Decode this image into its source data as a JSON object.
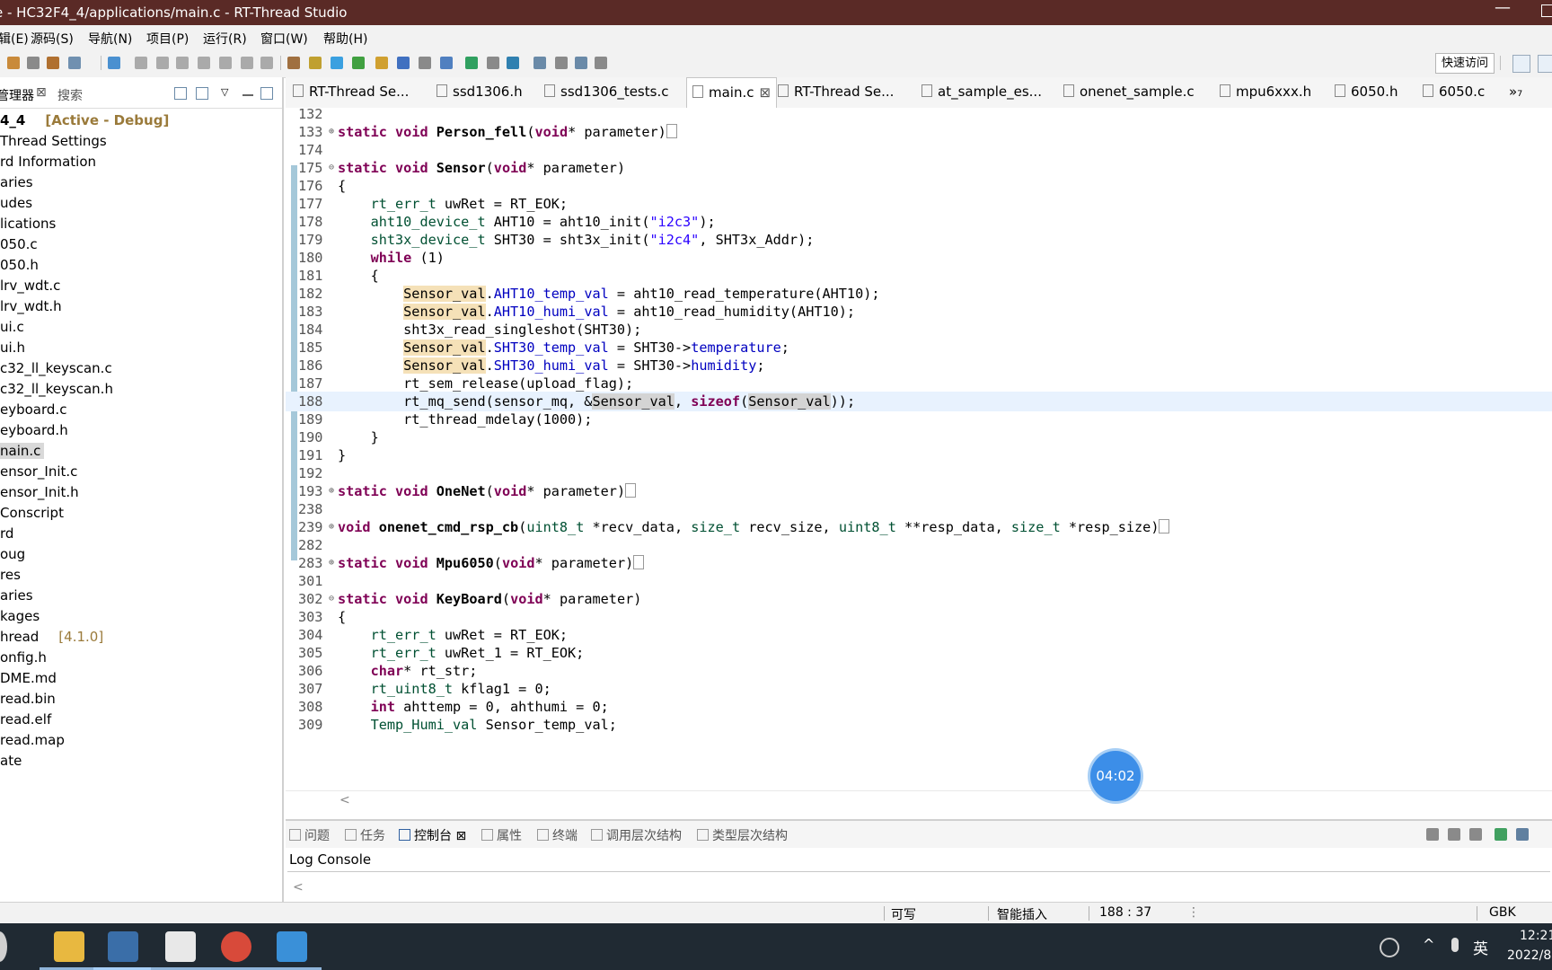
{
  "window": {
    "title": "e - HC32F4_4/applications/main.c - RT-Thread Studio",
    "min": "—"
  },
  "menu": [
    "辑(E)",
    "源码(S)",
    "导航(N)",
    "项目(P)",
    "运行(R)",
    "窗口(W)",
    "帮助(H)"
  ],
  "toolbar": {
    "quick_access": "快速访问"
  },
  "explorer": {
    "tab_label": "管理器",
    "tab_close": "⊠",
    "search_tab": "搜索",
    "items": [
      {
        "text": "4_4",
        "suffix": "[Active - Debug]"
      },
      {
        "text": "Thread Settings"
      },
      {
        "text": "rd Information"
      },
      {
        "text": "aries"
      },
      {
        "text": "udes"
      },
      {
        "text": "lications"
      },
      {
        "text": "050.c"
      },
      {
        "text": "050.h"
      },
      {
        "text": "lrv_wdt.c"
      },
      {
        "text": "lrv_wdt.h"
      },
      {
        "text": "ui.c"
      },
      {
        "text": "ui.h"
      },
      {
        "text": "c32_ll_keyscan.c"
      },
      {
        "text": "c32_ll_keyscan.h"
      },
      {
        "text": "eyboard.c"
      },
      {
        "text": "eyboard.h"
      },
      {
        "text": "nain.c",
        "selected": true
      },
      {
        "text": "ensor_Init.c"
      },
      {
        "text": "ensor_Init.h"
      },
      {
        "text": "Conscript"
      },
      {
        "text": "rd"
      },
      {
        "text": "oug"
      },
      {
        "text": "res"
      },
      {
        "text": "aries"
      },
      {
        "text": "kages"
      },
      {
        "text": "hread",
        "suffix": "[4.1.0]"
      },
      {
        "text": "onfig.h"
      },
      {
        "text": "DME.md"
      },
      {
        "text": "read.bin"
      },
      {
        "text": "read.elf"
      },
      {
        "text": "read.map"
      },
      {
        "text": "ate"
      }
    ]
  },
  "tabs": [
    {
      "label": "RT-Thread Se..."
    },
    {
      "label": "ssd1306.h"
    },
    {
      "label": "ssd1306_tests.c"
    },
    {
      "label": "main.c",
      "active": true,
      "close": "⊠"
    },
    {
      "label": "RT-Thread Se..."
    },
    {
      "label": "at_sample_es..."
    },
    {
      "label": "onenet_sample.c"
    },
    {
      "label": "mpu6xxx.h"
    },
    {
      "label": "6050.h"
    },
    {
      "label": "6050.c"
    },
    {
      "label": "»₇"
    }
  ],
  "code_lines": [
    {
      "n": "132",
      "c": ""
    },
    {
      "n": "133",
      "f": "⊕",
      "c": "<span class='kw'>static</span> <span class='kw'>void</span> <span class='fn'>Person_fell</span>(<span class='kw'>void</span>* parameter)<span class='collapsed'></span>"
    },
    {
      "n": "174",
      "c": ""
    },
    {
      "n": "175",
      "f": "⊖",
      "c": "<span class='kw'>static</span> <span class='kw'>void</span> <span class='fn'>Sensor</span>(<span class='kw'>void</span>* parameter)"
    },
    {
      "n": "176",
      "c": "{"
    },
    {
      "n": "177",
      "c": "    <span class='ty'>rt_err_t</span> uwRet = RT_EOK;"
    },
    {
      "n": "178",
      "c": "    <span class='ty'>aht10_device_t</span> AHT10 = aht10_init(<span class='str'>\"i2c3\"</span>);"
    },
    {
      "n": "179",
      "c": "    <span class='ty'>sht3x_device_t</span> SHT30 = sht3x_init(<span class='str'>\"i2c4\"</span>, SHT3x_Addr);"
    },
    {
      "n": "180",
      "c": "    <span class='kw'>while</span> (1)"
    },
    {
      "n": "181",
      "c": "    {"
    },
    {
      "n": "182",
      "c": "        <span class='hl'>Sensor_val</span>.<span class='fld'>AHT10_temp_val</span> = aht10_read_temperature(AHT10);"
    },
    {
      "n": "183",
      "c": "        <span class='hl'>Sensor_val</span>.<span class='fld'>AHT10_humi_val</span> = aht10_read_humidity(AHT10);"
    },
    {
      "n": "184",
      "c": "        sht3x_read_singleshot(SHT30);"
    },
    {
      "n": "185",
      "c": "        <span class='hl'>Sensor_val</span>.<span class='fld'>SHT30_temp_val</span> = SHT30-><span class='fld'>temperature</span>;"
    },
    {
      "n": "186",
      "c": "        <span class='hl'>Sensor_val</span>.<span class='fld'>SHT30_humi_val</span> = SHT30-><span class='fld'>humidity</span>;"
    },
    {
      "n": "187",
      "c": "        rt_sem_release(upload_flag);"
    },
    {
      "n": "188",
      "current": true,
      "c": "        rt_mq_send(sensor_mq, &amp;<span class='hl2'>Sensor_val</span>, <span class='kw'>sizeof</span>(<span class='hl2'>Sensor_val</span>));"
    },
    {
      "n": "189",
      "c": "        rt_thread_mdelay(1000);"
    },
    {
      "n": "190",
      "c": "    }"
    },
    {
      "n": "191",
      "c": "}"
    },
    {
      "n": "192",
      "c": ""
    },
    {
      "n": "193",
      "f": "⊕",
      "c": "<span class='kw'>static</span> <span class='kw'>void</span> <span class='fn'>OneNet</span>(<span class='kw'>void</span>* parameter)<span class='collapsed'></span>"
    },
    {
      "n": "238",
      "c": ""
    },
    {
      "n": "239",
      "f": "⊕",
      "c": "<span class='kw'>void</span> <span class='fn'>onenet_cmd_rsp_cb</span>(<span class='ty'>uint8_t</span> *recv_data, <span class='ty'>size_t</span> recv_size, <span class='ty'>uint8_t</span> **resp_data, <span class='ty'>size_t</span> *resp_size)<span class='collapsed'></span>"
    },
    {
      "n": "282",
      "c": ""
    },
    {
      "n": "283",
      "f": "⊕",
      "c": "<span class='kw'>static</span> <span class='kw'>void</span> <span class='fn'>Mpu6050</span>(<span class='kw'>void</span>* parameter)<span class='collapsed'></span>"
    },
    {
      "n": "301",
      "c": ""
    },
    {
      "n": "302",
      "f": "⊖",
      "c": "<span class='kw'>static</span> <span class='kw'>void</span> <span class='fn'>KeyBoard</span>(<span class='kw'>void</span>* parameter)"
    },
    {
      "n": "303",
      "c": "{"
    },
    {
      "n": "304",
      "c": "    <span class='ty'>rt_err_t</span> uwRet = RT_EOK;"
    },
    {
      "n": "305",
      "c": "    <span class='ty'>rt_err_t</span> uwRet_1 = RT_EOK;"
    },
    {
      "n": "306",
      "c": "    <span class='kw'>char</span>* rt_str;"
    },
    {
      "n": "307",
      "c": "    <span class='ty'>rt_uint8_t</span> kflag1 = 0;"
    },
    {
      "n": "308",
      "c": "    <span class='kw'>int</span> ahttemp = 0, ahthumi = 0;"
    },
    {
      "n": "309",
      "c": "    <span class='ty'>Temp_Humi_val</span> Sensor_temp_val;"
    }
  ],
  "timer": "04:02",
  "bottom_panel": {
    "tabs": [
      {
        "label": "问题"
      },
      {
        "label": "任务"
      },
      {
        "label": "控制台",
        "active": true,
        "close": "⊠"
      },
      {
        "label": "属性"
      },
      {
        "label": "终端"
      },
      {
        "label": "调用层次结构"
      },
      {
        "label": "类型层次结构"
      }
    ],
    "console_title": "Log Console",
    "scroll_arrow": "<"
  },
  "status": {
    "writable": "可写",
    "insert_mode": "智能插入",
    "position": "188 : 37",
    "encoding": "GBK",
    "more": "⋮"
  },
  "taskbar": {
    "tray_lang": "英",
    "time": "12:21",
    "date": "2022/8",
    "chevron": "^"
  },
  "colors": {
    "titlebar": "#5a2a26",
    "accent": "#3c8ee8",
    "keyword": "#7f0055",
    "string": "#2a00ff",
    "field": "#0000c0"
  }
}
